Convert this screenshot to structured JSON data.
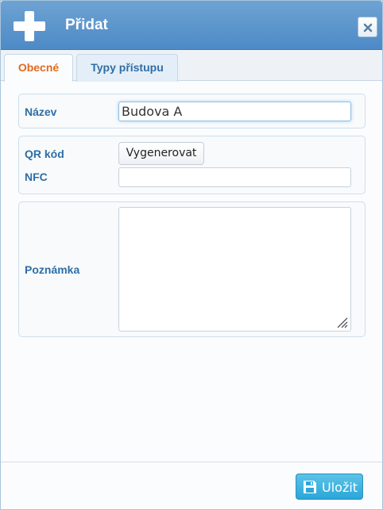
{
  "dialog": {
    "title": "Přidat",
    "title_icon": "plus-icon",
    "close_icon": "close-icon"
  },
  "tabs": [
    {
      "label": "Obecné",
      "active": true
    },
    {
      "label": "Typy přístupu",
      "active": false
    }
  ],
  "form": {
    "name_label": "Název",
    "name_value": "Budova A",
    "qr_label": "QR kód",
    "qr_button": "Vygenerovat",
    "nfc_label": "NFC",
    "nfc_value": "",
    "note_label": "Poznámka",
    "note_value": ""
  },
  "footer": {
    "save_label": "Uložit",
    "save_icon": "floppy-disk-icon"
  },
  "colors": {
    "titlebar": "#4d8ac6",
    "label": "#2e6ea6",
    "active_tab": "#e06b1f",
    "save_button": "#2aa7d9"
  }
}
